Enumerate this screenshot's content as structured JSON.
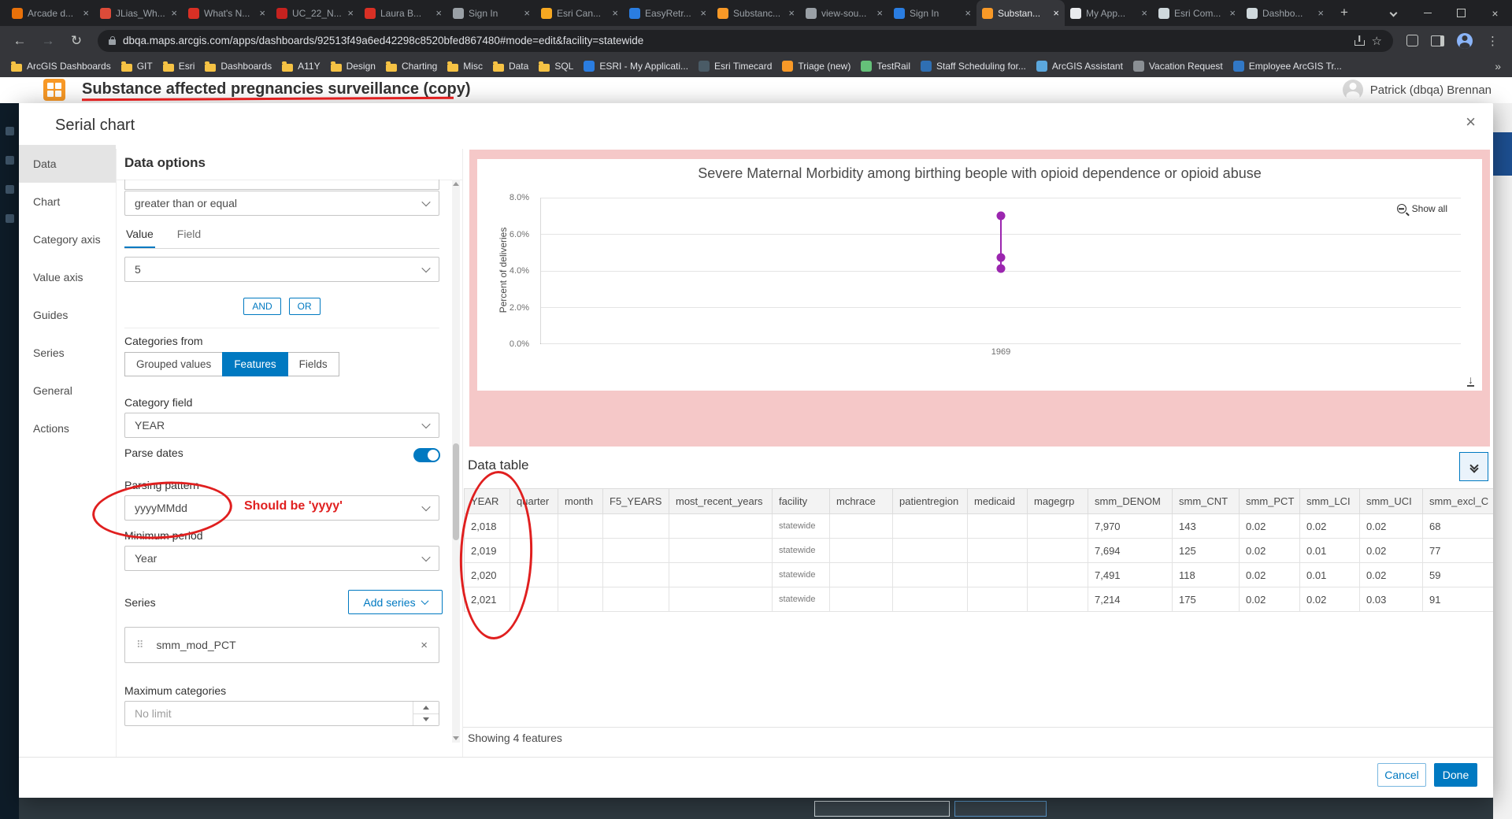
{
  "icons": {
    "close": "×",
    "back": "←",
    "forward": "→",
    "reload": "↻",
    "star": "☆",
    "kebab": "⋮",
    "new_tab": "+",
    "overflow": "»",
    "drag": "⠿",
    "download": "↓"
  },
  "browser": {
    "tabs": [
      {
        "title": "Arcade d...",
        "color": "#e8710a"
      },
      {
        "title": "JLias_Wh...",
        "color": "#dd4b39"
      },
      {
        "title": "What's N...",
        "color": "#d93025"
      },
      {
        "title": "UC_22_N...",
        "color": "#c5221f"
      },
      {
        "title": "Laura B...",
        "color": "#d93025"
      },
      {
        "title": "Sign In",
        "color": "#9aa0a6"
      },
      {
        "title": "Esri Can...",
        "color": "#f6a821"
      },
      {
        "title": "EasyRetr...",
        "color": "#2a7de1"
      },
      {
        "title": "Substanc...",
        "color": "#f89927"
      },
      {
        "title": "view-sou...",
        "color": "#9aa0a6"
      },
      {
        "title": "Sign In",
        "color": "#2a7de1"
      },
      {
        "title": "Substan...",
        "color": "#f89927",
        "active": true
      },
      {
        "title": "My App...",
        "color": "#e8eaed"
      },
      {
        "title": "Esri Com...",
        "color": "#cfd8dc"
      },
      {
        "title": "Dashbo...",
        "color": "#cfd8dc"
      }
    ],
    "url": "dbqa.maps.arcgis.com/apps/dashboards/92513f49a6ed42298c8520bfed867480#mode=edit&facility=statewide",
    "bookmarks": [
      {
        "label": "ArcGIS Dashboards",
        "folder": true
      },
      {
        "label": "GIT",
        "folder": true
      },
      {
        "label": "Esri",
        "folder": true
      },
      {
        "label": "Dashboards",
        "folder": true
      },
      {
        "label": "A11Y",
        "folder": true
      },
      {
        "label": "Design",
        "folder": true
      },
      {
        "label": "Charting",
        "folder": true
      },
      {
        "label": "Misc",
        "folder": true
      },
      {
        "label": "Data",
        "folder": true
      },
      {
        "label": "SQL",
        "folder": true
      },
      {
        "label": "ESRI - My Applicati...",
        "color": "#2a7de1"
      },
      {
        "label": "Esri Timecard",
        "color": "#4a5b66"
      },
      {
        "label": "Triage (new)",
        "color": "#f89927"
      },
      {
        "label": "TestRail",
        "color": "#65c179"
      },
      {
        "label": "Staff Scheduling for...",
        "color": "#2f6fb3"
      },
      {
        "label": "ArcGIS Assistant",
        "color": "#5ba7dd"
      },
      {
        "label": "Vacation Request",
        "color": "#8a8f94"
      },
      {
        "label": "Employee ArcGIS Tr...",
        "color": "#3178c6"
      }
    ]
  },
  "page": {
    "title": "Substance affected pregnancies surveillance (copy)",
    "user_name": "Patrick (dbqa) Brennan"
  },
  "modal": {
    "title": "Serial chart",
    "nav": {
      "items": [
        {
          "label": "Data",
          "active": true
        },
        {
          "label": "Chart"
        },
        {
          "label": "Category axis"
        },
        {
          "label": "Value axis"
        },
        {
          "label": "Guides"
        },
        {
          "label": "Series"
        },
        {
          "label": "General"
        },
        {
          "label": "Actions"
        }
      ]
    },
    "data_options": {
      "heading": "Data options",
      "operator_value": "greater than or equal",
      "value_tab": "Value",
      "field_tab": "Field",
      "condition_value": "5",
      "and_label": "AND",
      "or_label": "OR",
      "categories_from_label": "Categories from",
      "grouped_values_label": "Grouped values",
      "features_label": "Features",
      "fields_label": "Fields",
      "category_field_label": "Category field",
      "category_field_value": "YEAR",
      "parse_dates_label": "Parse dates",
      "parsing_pattern_label": "Parsing pattern",
      "parsing_pattern_value": "yyyyMMdd",
      "minimum_period_label": "Minimum period",
      "minimum_period_value": "Year",
      "series_label": "Series",
      "add_series_label": "Add series",
      "series_item": "smm_mod_PCT",
      "maximum_categories_label": "Maximum categories",
      "maximum_categories_placeholder": "No limit"
    },
    "preview": {
      "show_all_label": "Show all"
    },
    "data_table": {
      "title": "Data table",
      "columns": [
        "YEAR",
        "quarter",
        "month",
        "F5_YEARS",
        "most_recent_years",
        "facility",
        "mchrace",
        "patientregion",
        "medicaid",
        "magegrp",
        "smm_DENOM",
        "smm_CNT",
        "smm_PCT",
        "smm_LCI",
        "smm_UCI",
        "smm_excl_C"
      ],
      "rows": [
        [
          "2,018",
          "",
          "",
          "",
          "",
          "statewide",
          "",
          "",
          "",
          "",
          "7,970",
          "143",
          "0.02",
          "0.02",
          "0.02",
          "68"
        ],
        [
          "2,019",
          "",
          "",
          "",
          "",
          "statewide",
          "",
          "",
          "",
          "",
          "7,694",
          "125",
          "0.02",
          "0.01",
          "0.02",
          "77"
        ],
        [
          "2,020",
          "",
          "",
          "",
          "",
          "statewide",
          "",
          "",
          "",
          "",
          "7,491",
          "118",
          "0.02",
          "0.01",
          "0.02",
          "59"
        ],
        [
          "2,021",
          "",
          "",
          "",
          "",
          "statewide",
          "",
          "",
          "",
          "",
          "7,214",
          "175",
          "0.02",
          "0.02",
          "0.03",
          "91"
        ]
      ],
      "status": "Showing 4 features"
    },
    "footer": {
      "cancel_label": "Cancel",
      "done_label": "Done"
    }
  },
  "annotations": {
    "parsing_note": "Should be 'yyyy'"
  },
  "chart_data": {
    "type": "scatter",
    "title": "Severe Maternal Morbidity among birthing beople with opioid dependence or opioid abuse",
    "xlabel": "",
    "ylabel": "Percent of deliveries",
    "x_ticks": [
      "1969"
    ],
    "y_ticks": [
      "8.0%",
      "6.0%",
      "4.0%",
      "2.0%",
      "0.0%"
    ],
    "ylim": [
      0,
      8
    ],
    "grid": true,
    "legend": "none",
    "series": [
      {
        "name": "smm_mod_PCT",
        "color": "#9b26af",
        "points": [
          {
            "x": "1969",
            "y": 7.0
          },
          {
            "x": "1969",
            "y": 4.7
          },
          {
            "x": "1969",
            "y": 4.1
          }
        ]
      }
    ]
  }
}
